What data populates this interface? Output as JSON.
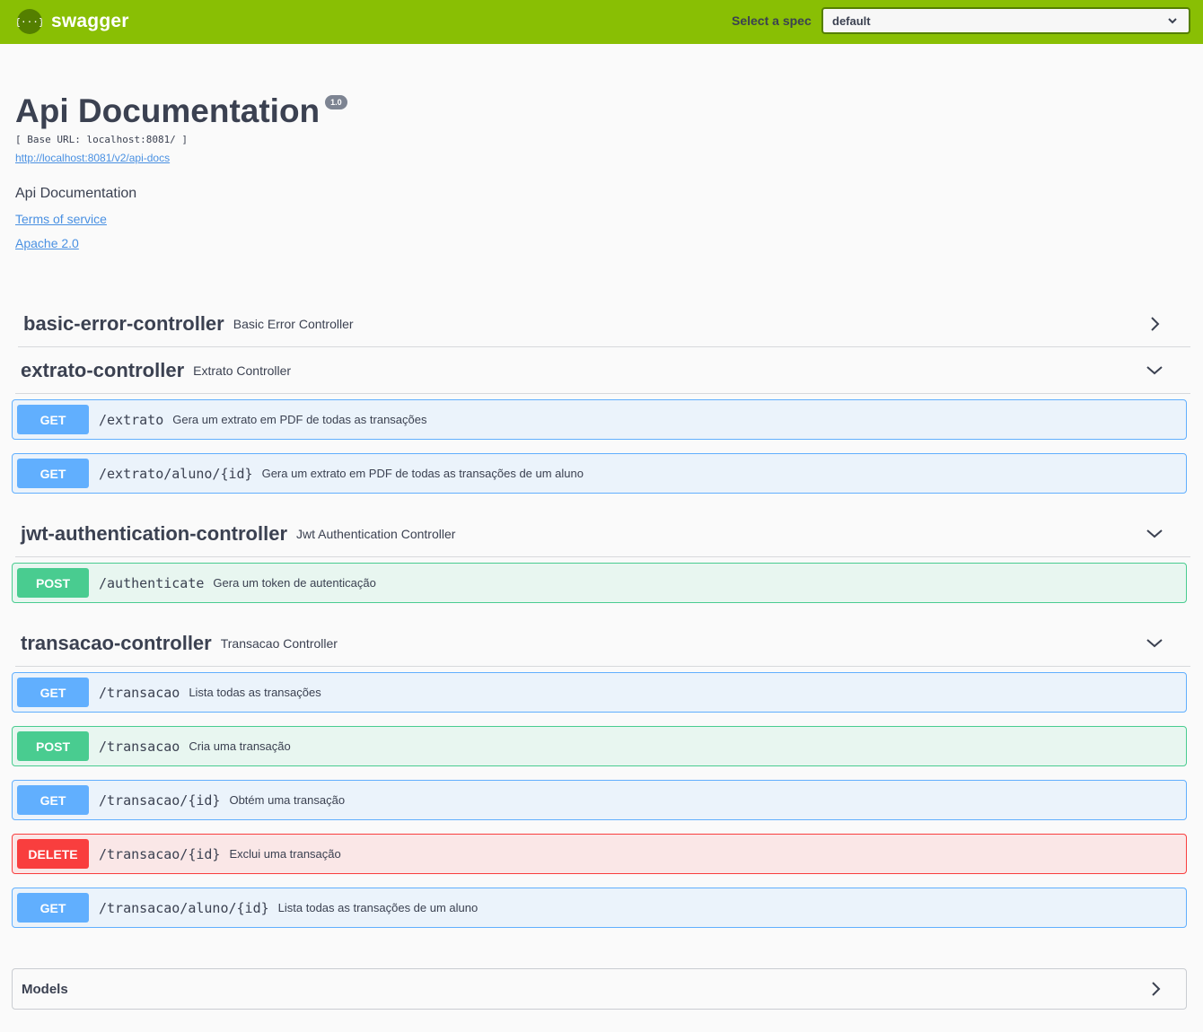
{
  "topbar": {
    "logo_text": "swagger",
    "spec_label": "Select a spec",
    "spec_value": "default"
  },
  "info": {
    "title": "Api Documentation",
    "version": "1.0",
    "base_url": "[ Base URL: localhost:8081/ ]",
    "docs_url": "http://localhost:8081/v2/api-docs",
    "description": "Api Documentation",
    "terms": "Terms of service",
    "license": "Apache 2.0"
  },
  "tags": [
    {
      "name": "basic-error-controller",
      "description": "Basic Error Controller",
      "expanded": false
    },
    {
      "name": "extrato-controller",
      "description": "Extrato Controller",
      "expanded": true
    },
    {
      "name": "jwt-authentication-controller",
      "description": "Jwt Authentication Controller",
      "expanded": true
    },
    {
      "name": "transacao-controller",
      "description": "Transacao Controller",
      "expanded": true
    }
  ],
  "operations": [
    {
      "method": "GET",
      "path": "/extrato",
      "summary": "Gera um extrato em PDF de todas as transações"
    },
    {
      "method": "GET",
      "path": "/extrato/aluno/{id}",
      "summary": "Gera um extrato em PDF de todas as transações de um aluno"
    },
    {
      "method": "POST",
      "path": "/authenticate",
      "summary": "Gera um token de autenticação"
    },
    {
      "method": "GET",
      "path": "/transacao",
      "summary": "Lista todas as transações"
    },
    {
      "method": "POST",
      "path": "/transacao",
      "summary": "Cria uma transação"
    },
    {
      "method": "GET",
      "path": "/transacao/{id}",
      "summary": "Obtém uma transação"
    },
    {
      "method": "DELETE",
      "path": "/transacao/{id}",
      "summary": "Exclui uma transação"
    },
    {
      "method": "GET",
      "path": "/transacao/aluno/{id}",
      "summary": "Lista todas as transações de um aluno"
    }
  ],
  "models": {
    "label": "Models"
  },
  "colors": {
    "topbar": "#89bf04",
    "get": "#61affe",
    "post": "#49cc90",
    "delete": "#f93e3e"
  }
}
